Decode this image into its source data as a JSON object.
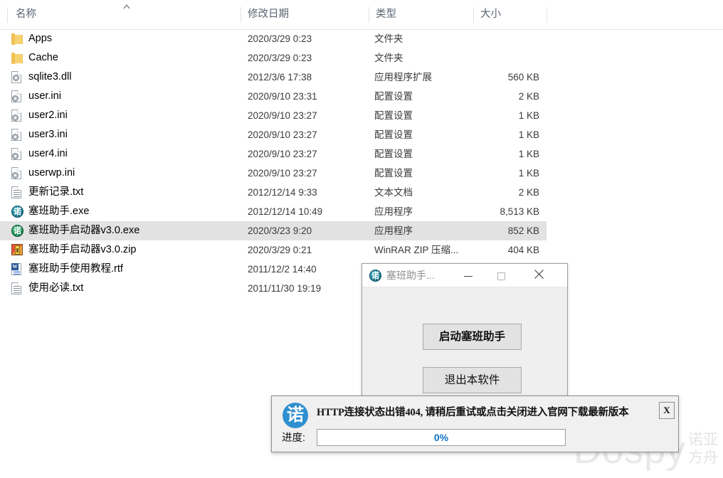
{
  "file_list": {
    "columns": [
      {
        "key": "name",
        "label": "名称",
        "sorted": true,
        "sort_direction": "ascending",
        "sort_glyph": "︿"
      },
      {
        "key": "date",
        "label": "修改日期"
      },
      {
        "key": "type",
        "label": "类型"
      },
      {
        "key": "size",
        "label": "大小"
      }
    ],
    "rows": [
      {
        "name": "Apps",
        "date": "2020/3/29 0:23",
        "type": "文件夹",
        "size": "",
        "icon": "folder-icon",
        "selected": false
      },
      {
        "name": "Cache",
        "date": "2020/3/29 0:23",
        "type": "文件夹",
        "size": "",
        "icon": "folder-icon",
        "selected": false
      },
      {
        "name": "sqlite3.dll",
        "date": "2012/3/6 17:38",
        "type": "应用程序扩展",
        "size": "560 KB",
        "icon": "dll-icon",
        "selected": false
      },
      {
        "name": "user.ini",
        "date": "2020/9/10 23:31",
        "type": "配置设置",
        "size": "2 KB",
        "icon": "ini-icon",
        "selected": false
      },
      {
        "name": "user2.ini",
        "date": "2020/9/10 23:27",
        "type": "配置设置",
        "size": "1 KB",
        "icon": "ini-icon",
        "selected": false
      },
      {
        "name": "user3.ini",
        "date": "2020/9/10 23:27",
        "type": "配置设置",
        "size": "1 KB",
        "icon": "ini-icon",
        "selected": false
      },
      {
        "name": "user4.ini",
        "date": "2020/9/10 23:27",
        "type": "配置设置",
        "size": "1 KB",
        "icon": "ini-icon",
        "selected": false
      },
      {
        "name": "userwp.ini",
        "date": "2020/9/10 23:27",
        "type": "配置设置",
        "size": "1 KB",
        "icon": "ini-icon",
        "selected": false
      },
      {
        "name": "更新记录.txt",
        "date": "2012/12/14 9:33",
        "type": "文本文档",
        "size": "2 KB",
        "icon": "text-file-icon",
        "selected": false
      },
      {
        "name": "塞班助手.exe",
        "date": "2012/12/14 10:49",
        "type": "应用程序",
        "size": "8,513 KB",
        "icon": "globe-exe-icon",
        "selected": false
      },
      {
        "name": "塞班助手启动器v3.0.exe",
        "date": "2020/3/23 9:20",
        "type": "应用程序",
        "size": "852 KB",
        "icon": "globe-exe-green-icon",
        "selected": true
      },
      {
        "name": "塞班助手启动器v3.0.zip",
        "date": "2020/3/29 0:21",
        "type": "WinRAR ZIP 压缩...",
        "size": "404 KB",
        "icon": "zip-icon",
        "selected": false
      },
      {
        "name": "塞班助手使用教程.rtf",
        "date": "2011/12/2 14:40",
        "type": "",
        "size": "",
        "icon": "rtf-icon",
        "selected": false
      },
      {
        "name": "使用必读.txt",
        "date": "2011/11/30 19:19",
        "type": "",
        "size": "",
        "icon": "text-file-icon",
        "selected": false
      }
    ]
  },
  "app_dialog": {
    "title": "塞班助手...",
    "icon": "globe-app-icon",
    "minimize_label": "—",
    "maximize_label": "□",
    "close_label": "✕",
    "launch_button": "启动塞班助手",
    "quit_button": "退出本软件"
  },
  "alert_dialog": {
    "logo_glyph": "诺",
    "message": "HTTP连接状态出错404, 请稍后重试或点击关闭进入官网下载最新版本",
    "progress_label": "进度:",
    "progress_value": "0%",
    "progress_percent": 0,
    "close_label": "X",
    "progress_text_color": "#1272c4"
  },
  "watermark": {
    "brand": "Dospy",
    "cn_line1": "诺亚",
    "cn_line2": "方舟"
  }
}
